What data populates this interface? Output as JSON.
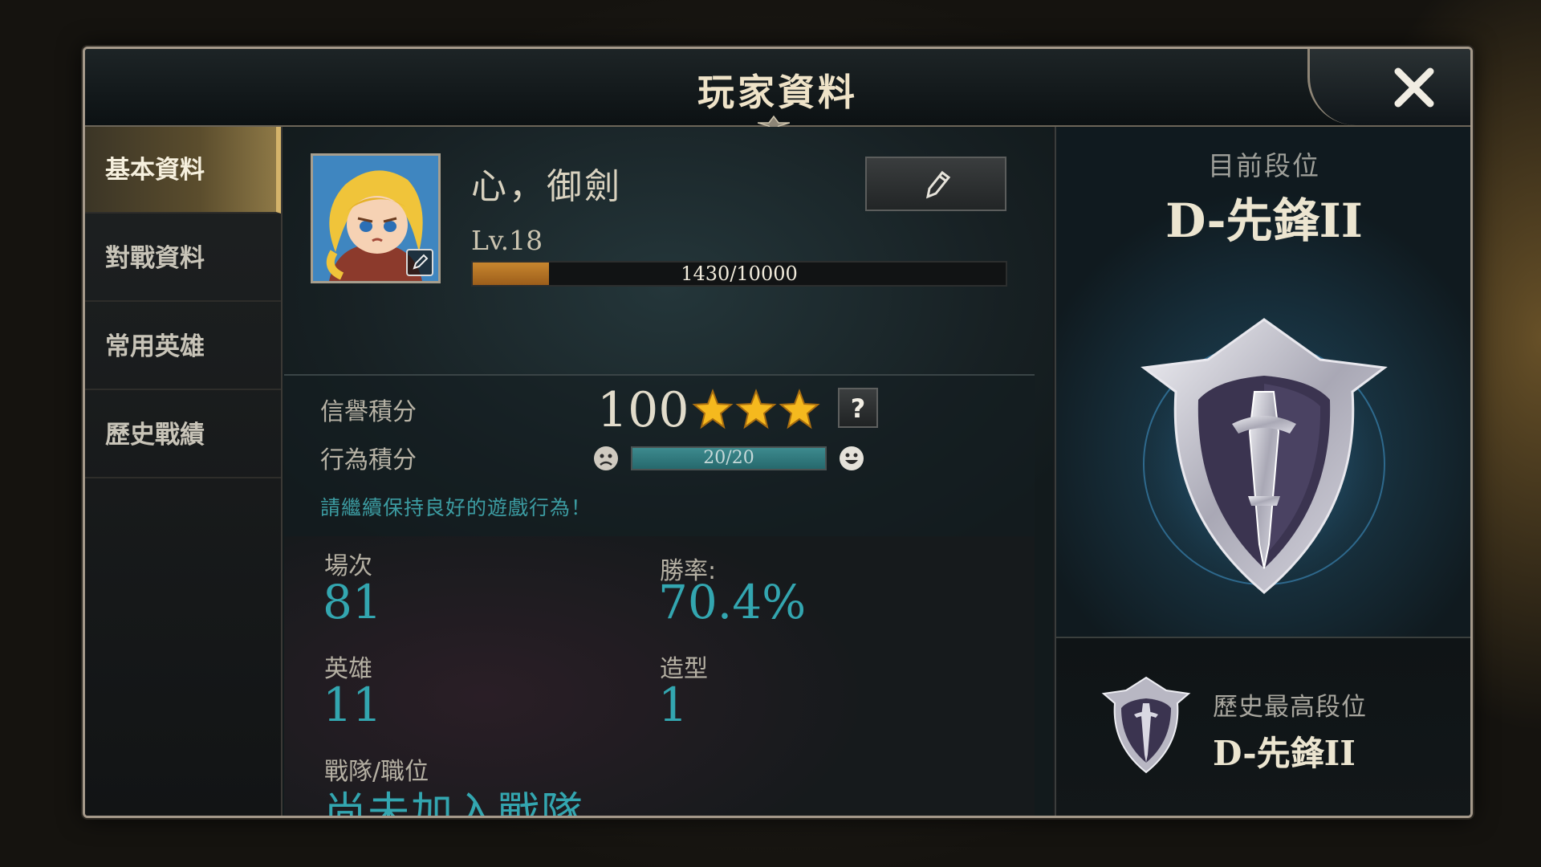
{
  "window": {
    "title": "玩家資料",
    "close_label": "close"
  },
  "sidebar": {
    "items": [
      {
        "label": "基本資料",
        "active": true
      },
      {
        "label": "對戰資料",
        "active": false
      },
      {
        "label": "常用英雄",
        "active": false
      },
      {
        "label": "歷史戰績",
        "active": false
      }
    ]
  },
  "profile": {
    "name": "心，御劍",
    "level": "Lv.18",
    "xp_text": "1430/10000",
    "xp_fraction": 0.143,
    "avatar_icon": "hero-portrait",
    "edit_icon": "pencil-icon"
  },
  "credit": {
    "credit_label": "信譽積分",
    "credit_value": "100",
    "stars": 3,
    "help_label": "?",
    "behavior_label": "行為積分",
    "behavior_text": "20/20",
    "behavior_fraction": 1.0,
    "hint": "請繼續保持良好的遊戲行為！"
  },
  "stats": {
    "matches_label": "場次",
    "matches_value": "81",
    "winrate_label": "勝率:",
    "winrate_value": "70.4%",
    "heroes_label": "英雄",
    "heroes_value": "11",
    "skins_label": "造型",
    "skins_value": "1",
    "team_label": "戰隊/職位",
    "team_value": "尚未加入戰隊"
  },
  "rank": {
    "current_label": "目前段位",
    "current_value": "D-先鋒II",
    "history_label": "歷史最高段位",
    "history_value": "D-先鋒II"
  },
  "colors": {
    "accent_teal": "#33a6b0",
    "xp_orange": "#c8862e",
    "star_gold": "#f5b91e",
    "active_tab_gold": "#d4b36a"
  }
}
